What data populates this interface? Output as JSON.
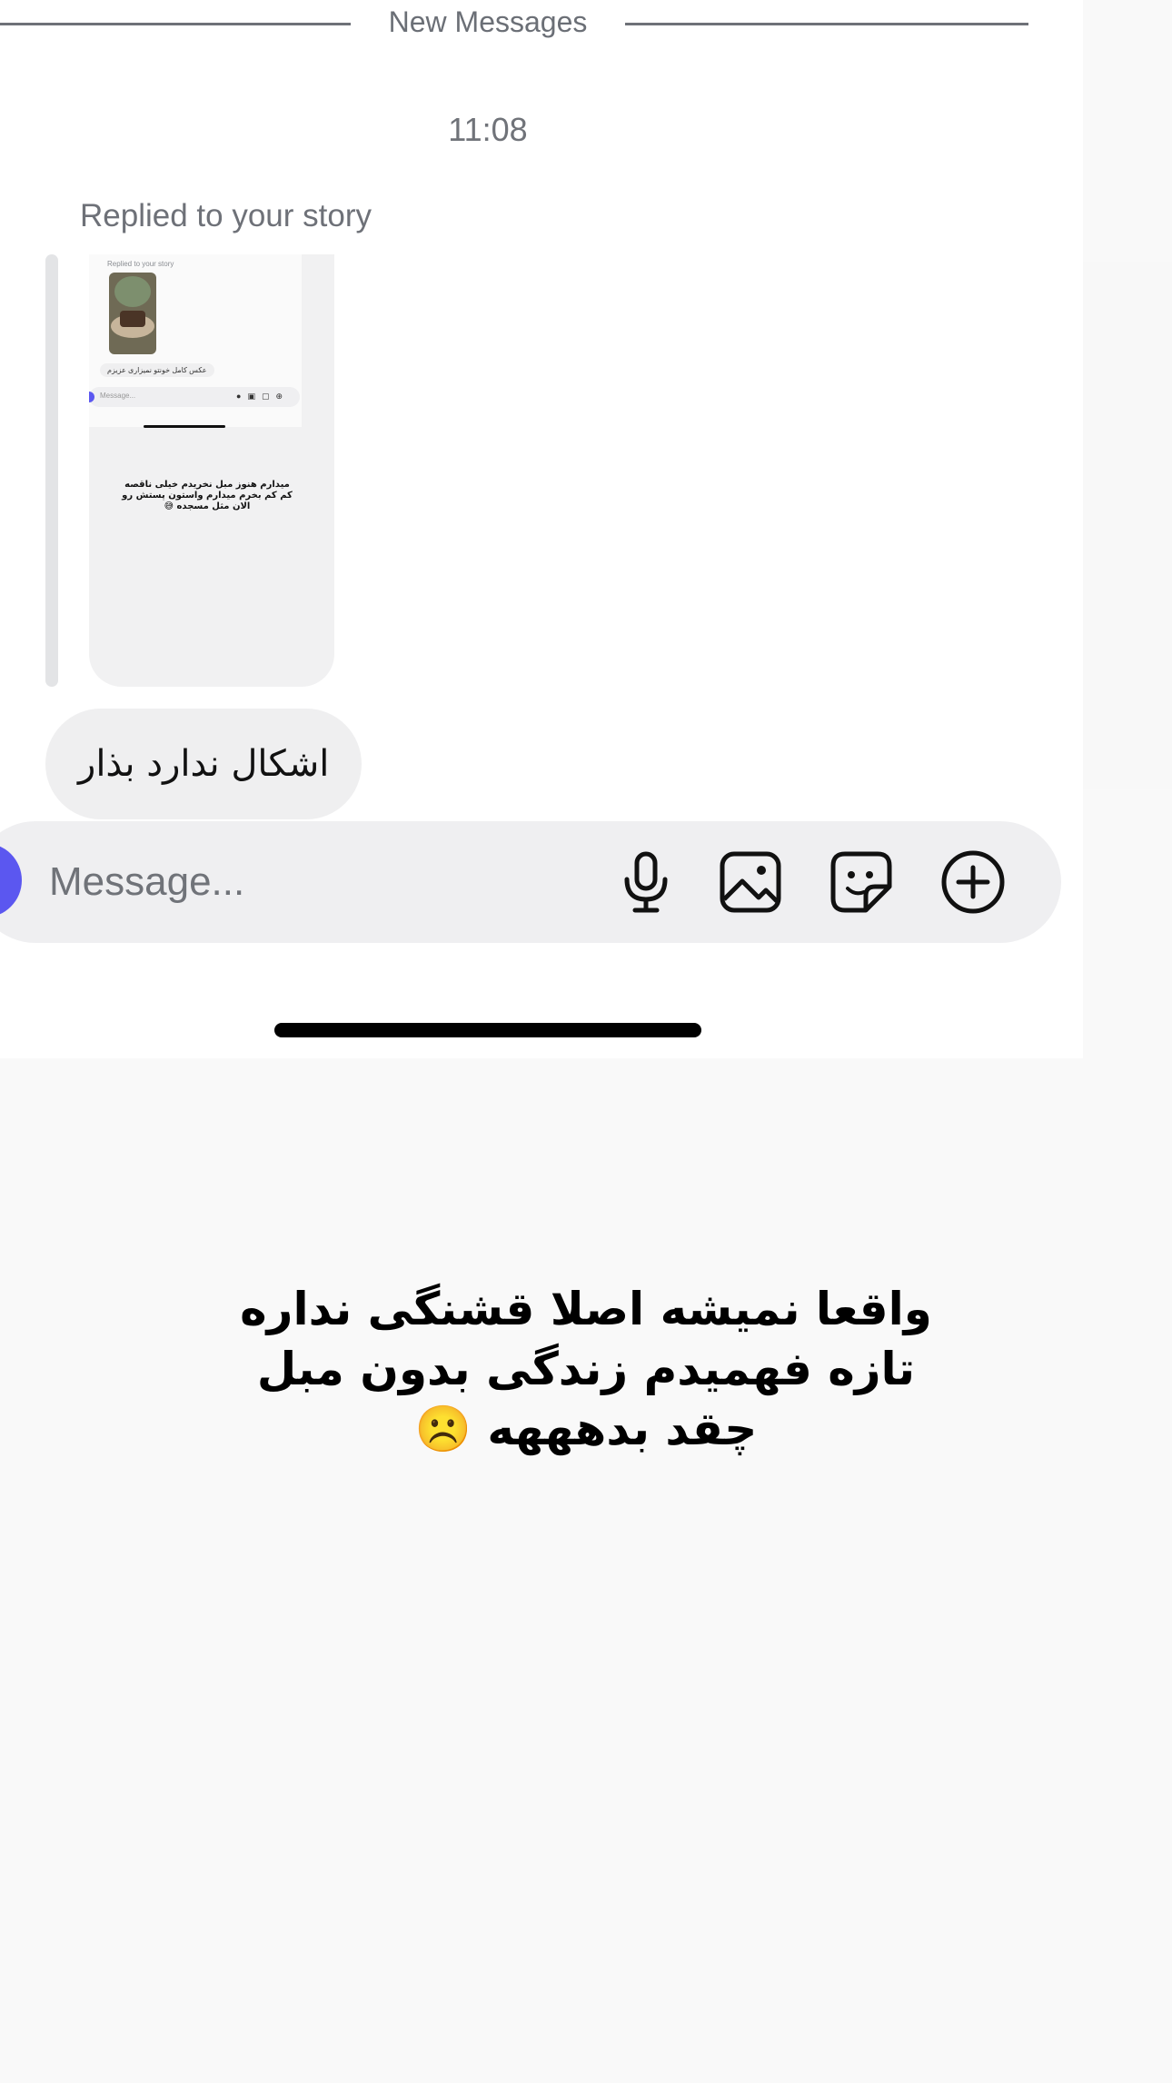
{
  "divider": {
    "label": "New Messages"
  },
  "timestamp": "11:08",
  "story_reply": {
    "caption": "Replied to your story",
    "preview": {
      "caption": "Replied to your story",
      "bubble": "عکس کامل خونتو نمیزاری عزیزم",
      "input_placeholder": "Message...",
      "lines": [
        "میدارم هنوز مبل نخریدم خیلی ناقصه",
        "کم کم بخرم میدارم واستون پستش رو",
        "الان مثل مسجده 😅"
      ]
    }
  },
  "message_bubble": {
    "text": "اشکال ندارد بذار"
  },
  "composer": {
    "placeholder": "Message...",
    "icons": [
      "microphone-icon",
      "image-icon",
      "sticker-icon",
      "plus-icon"
    ]
  },
  "story_text": {
    "lines": [
      "واقعا نمیشه اصلا قشنگی نداره",
      "تازه فهمیدم زندگی بدون مبل",
      "چقد بدهههه ☹️"
    ]
  },
  "colors": {
    "accent": "#5b57f0",
    "bubble": "#efeff0",
    "muted_text": "#6e7178"
  }
}
